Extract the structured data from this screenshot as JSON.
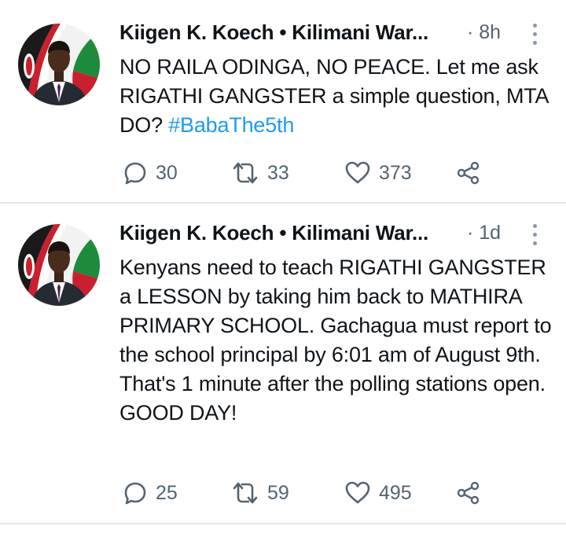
{
  "tweets": [
    {
      "author": "Kiigen K. Koech • Kilimani War...",
      "time": "8h",
      "text": "NO RAILA ODINGA, NO PEACE. Let me ask RIGATHI GANGSTER a simple question, MTA DO? ",
      "hashtag": "#BabaThe5th",
      "replies": "30",
      "retweets": "33",
      "likes": "373"
    },
    {
      "author": "Kiigen K. Koech • Kilimani War...",
      "time": "1d",
      "text": "Kenyans need to teach RIGATHI GANGSTER a LESSON by taking him back to MATHIRA PRIMARY SCHOOL. Gachagua must report to the school principal by 6:01 am of August 9th. That's 1 minute after the polling stations open. GOOD DAY!",
      "replies": "25",
      "retweets": "59",
      "likes": "495"
    }
  ],
  "icons": {
    "reply": "reply-icon",
    "retweet": "retweet-icon",
    "like": "heart-icon",
    "share": "share-icon",
    "more": "more-vertical-icon"
  },
  "colors": {
    "hashtag": "#1d9bf0",
    "secondary_text": "#536471",
    "divider": "#e1e6ea"
  }
}
